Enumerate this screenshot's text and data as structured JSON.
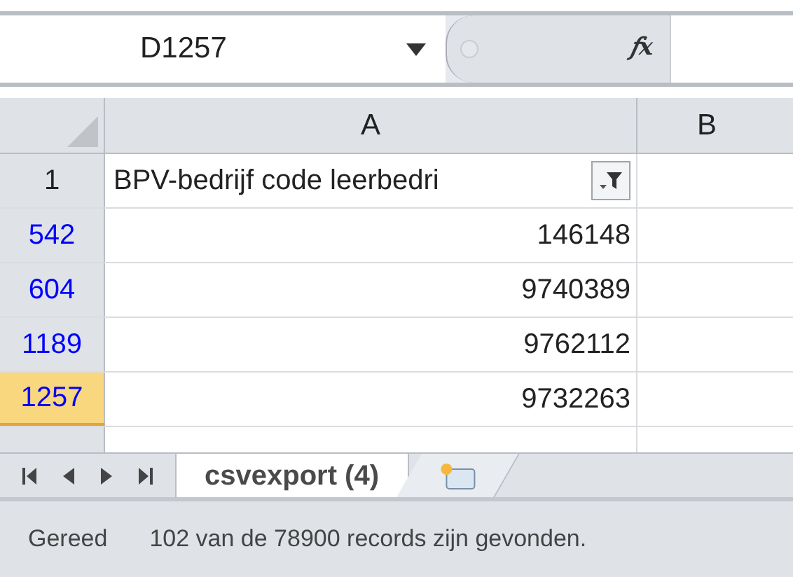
{
  "formula_bar": {
    "name_box": "D1257",
    "fx": "𝑓x"
  },
  "columns": [
    {
      "label": "A"
    },
    {
      "label": "B"
    }
  ],
  "rows": [
    {
      "number": "1",
      "filtered": false,
      "selected": false,
      "cell_a": "BPV-bedrijf code leerbedri",
      "filter_button": true
    },
    {
      "number": "542",
      "filtered": true,
      "selected": false,
      "cell_a": "146148",
      "filter_button": false
    },
    {
      "number": "604",
      "filtered": true,
      "selected": false,
      "cell_a": "9740389",
      "filter_button": false
    },
    {
      "number": "1189",
      "filtered": true,
      "selected": false,
      "cell_a": "9762112",
      "filter_button": false
    },
    {
      "number": "1257",
      "filtered": true,
      "selected": true,
      "cell_a": "9732263",
      "filter_button": false
    }
  ],
  "sheet_tabs": [
    {
      "label": "csvexport (4)",
      "selected": true
    }
  ],
  "status_bar": {
    "mode": "Gereed",
    "message": "102 van de 78900 records zijn gevonden."
  }
}
